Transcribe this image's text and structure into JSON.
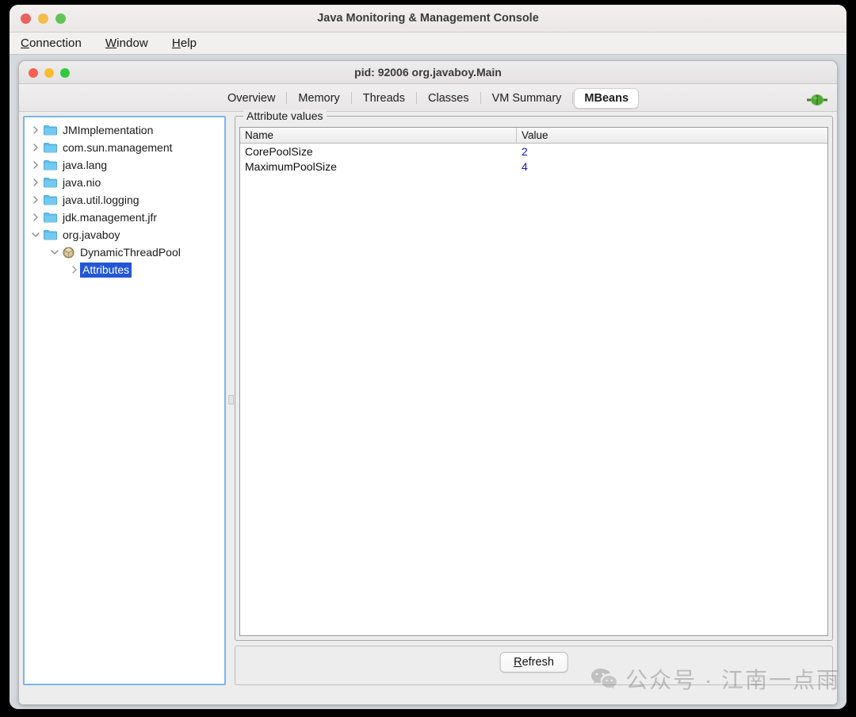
{
  "outer_window": {
    "title": "Java Monitoring & Management Console",
    "traffic_lights": [
      "close",
      "minimize",
      "zoom"
    ],
    "colors": {
      "close": "#e9635c",
      "minimize": "#f2bd4b",
      "zoom": "#61c454"
    }
  },
  "menubar": {
    "items": [
      {
        "label": "Connection",
        "mnemonic": "C"
      },
      {
        "label": "Window",
        "mnemonic": "W"
      },
      {
        "label": "Help",
        "mnemonic": "H"
      }
    ]
  },
  "inner_window": {
    "title": "pid: 92006 org.javaboy.Main",
    "colors": {
      "close": "#fc5f57",
      "minimize": "#fdbc2e",
      "zoom": "#2fca41"
    }
  },
  "tabs": {
    "items": [
      {
        "label": "Overview",
        "selected": false
      },
      {
        "label": "Memory",
        "selected": false
      },
      {
        "label": "Threads",
        "selected": false
      },
      {
        "label": "Classes",
        "selected": false
      },
      {
        "label": "VM Summary",
        "selected": false
      },
      {
        "label": "MBeans",
        "selected": true
      }
    ],
    "connect_icon": "connection-plug-icon"
  },
  "tree": {
    "nodes": [
      {
        "label": "JMImplementation",
        "indent": 0,
        "icon": "folder-icon",
        "expanded": false,
        "has_twisty": true,
        "selected": false
      },
      {
        "label": "com.sun.management",
        "indent": 0,
        "icon": "folder-icon",
        "expanded": false,
        "has_twisty": true,
        "selected": false
      },
      {
        "label": "java.lang",
        "indent": 0,
        "icon": "folder-icon",
        "expanded": false,
        "has_twisty": true,
        "selected": false
      },
      {
        "label": "java.nio",
        "indent": 0,
        "icon": "folder-icon",
        "expanded": false,
        "has_twisty": true,
        "selected": false
      },
      {
        "label": "java.util.logging",
        "indent": 0,
        "icon": "folder-icon",
        "expanded": false,
        "has_twisty": true,
        "selected": false
      },
      {
        "label": "jdk.management.jfr",
        "indent": 0,
        "icon": "folder-icon",
        "expanded": false,
        "has_twisty": true,
        "selected": false
      },
      {
        "label": "org.javaboy",
        "indent": 0,
        "icon": "folder-icon",
        "expanded": true,
        "has_twisty": true,
        "selected": false
      },
      {
        "label": "DynamicThreadPool",
        "indent": 1,
        "icon": "mbean-icon",
        "expanded": true,
        "has_twisty": true,
        "selected": false
      },
      {
        "label": "Attributes",
        "indent": 2,
        "icon": "none",
        "expanded": false,
        "has_twisty": true,
        "selected": true
      }
    ]
  },
  "attributes_panel": {
    "group_title": "Attribute values",
    "columns": [
      "Name",
      "Value"
    ],
    "rows": [
      {
        "name": "CorePoolSize",
        "value": "2"
      },
      {
        "name": "MaximumPoolSize",
        "value": "4"
      }
    ],
    "value_color": "#1414c8"
  },
  "footer": {
    "refresh_label": "Refresh",
    "refresh_mnemonic": "R"
  },
  "watermark": {
    "text": "公众号 · 江南一点雨",
    "icon": "wechat-icon"
  }
}
